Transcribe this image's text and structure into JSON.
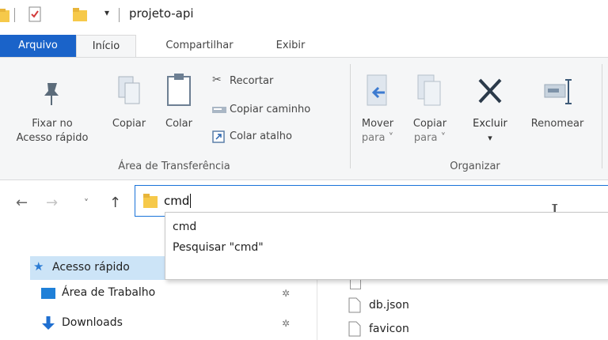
{
  "window": {
    "title": "projeto-api",
    "quick_access_caret": "▾"
  },
  "tabs": [
    {
      "label": "Arquivo"
    },
    {
      "label": "Início"
    },
    {
      "label": "Compartilhar"
    },
    {
      "label": "Exibir"
    }
  ],
  "ribbon": {
    "clipboard": {
      "pin_label_1": "Fixar no",
      "pin_label_2": "Acesso rápido",
      "copy_label": "Copiar",
      "paste_label": "Colar",
      "cut_label": "Recortar",
      "copy_path_label": "Copiar caminho",
      "paste_shortcut_label": "Colar atalho",
      "group_label": "Área de Transferência"
    },
    "organize": {
      "move_label_1": "Mover",
      "move_label_2": "para ˅",
      "copyto_label_1": "Copiar",
      "copyto_label_2": "para ˅",
      "delete_label": "Excluir",
      "delete_caret": "▾",
      "rename_label": "Renomear",
      "group_label": "Organizar"
    }
  },
  "navigation": {
    "back": "←",
    "forward": "→",
    "recent": "˅",
    "up": "↑"
  },
  "address_bar": {
    "value": "cmd"
  },
  "autocomplete": {
    "items": [
      "cmd",
      "Pesquisar \"cmd\""
    ]
  },
  "nav_pane": {
    "items": [
      {
        "label": "Acesso rápido"
      },
      {
        "label": "Área de Trabalho"
      },
      {
        "label": "Downloads"
      }
    ],
    "pin_glyph": "✲"
  },
  "files": [
    {
      "name": "db.json"
    },
    {
      "name": "favicon"
    }
  ],
  "colors": {
    "accent": "#1a63c9",
    "ribbon_bg": "#f5f6f7",
    "selection": "#cce4f7",
    "folder": "#f6c94a"
  }
}
